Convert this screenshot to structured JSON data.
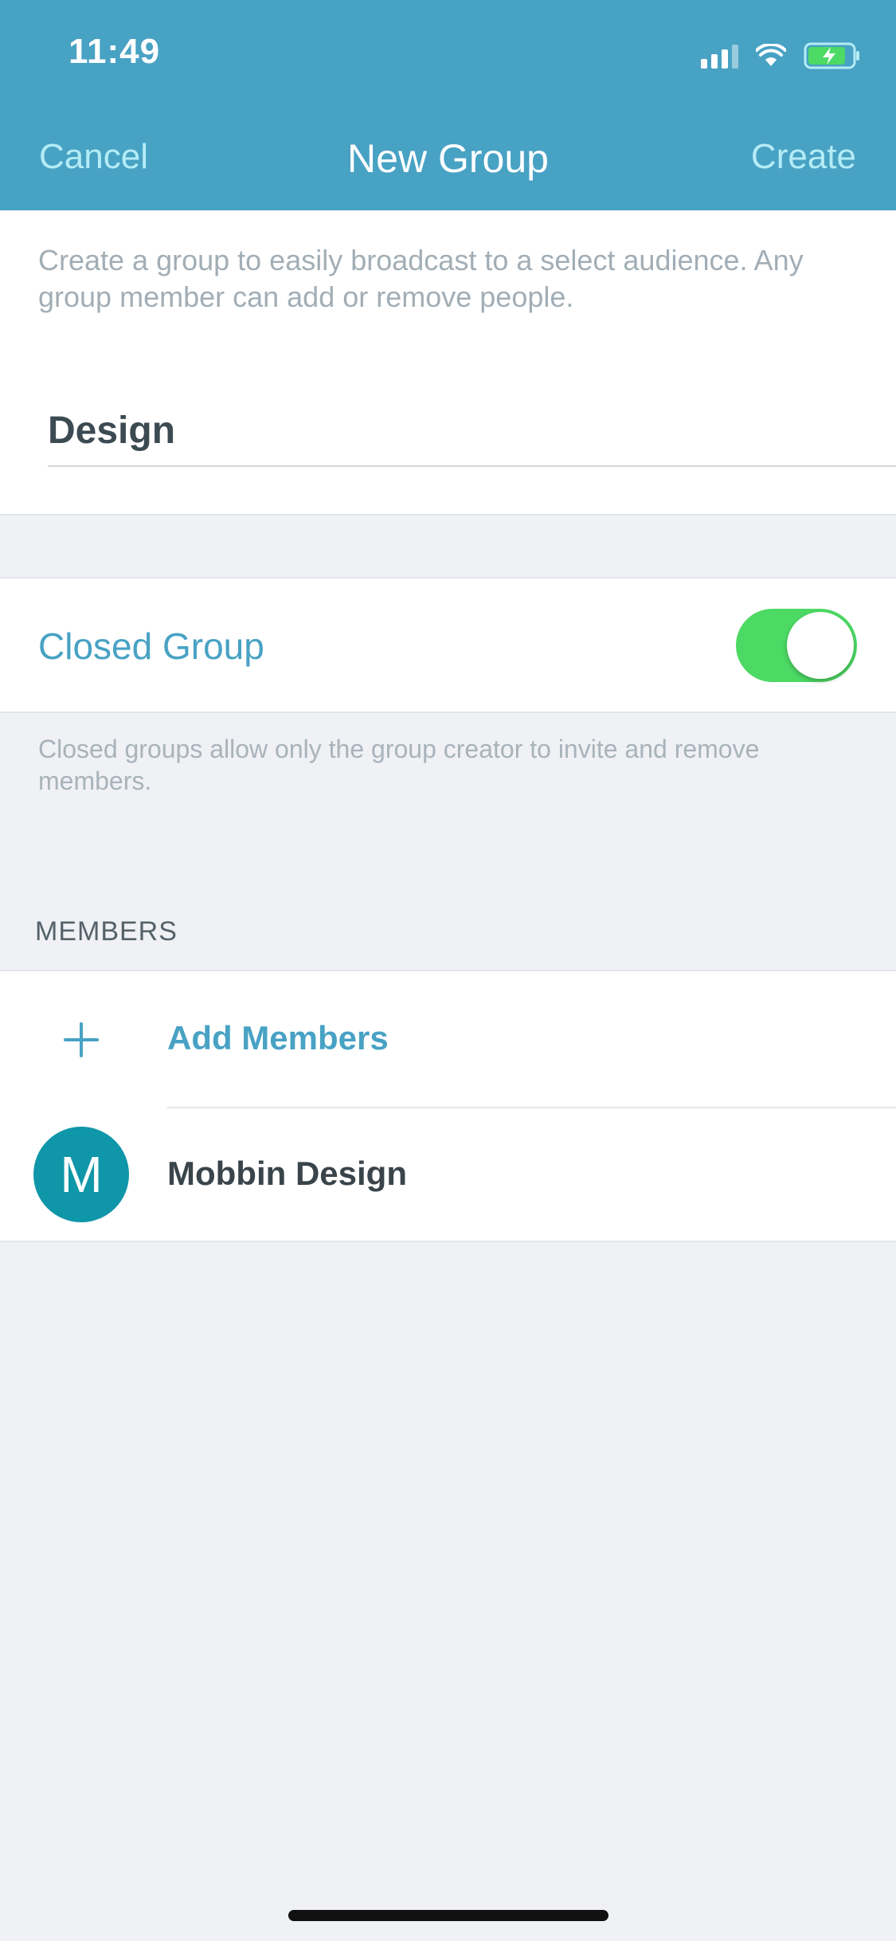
{
  "status_bar": {
    "time": "11:49",
    "icons": [
      "signal-icon",
      "wifi-icon",
      "battery-charging-icon"
    ]
  },
  "nav": {
    "cancel_label": "Cancel",
    "title": "New Group",
    "create_label": "Create"
  },
  "intro": {
    "description": "Create a group to easily broadcast to a select audience. Any group member can add or remove people.",
    "group_name_value": "Design"
  },
  "closed_group": {
    "label": "Closed Group",
    "enabled": true,
    "note": "Closed groups allow only the group creator to invite and remove members."
  },
  "members": {
    "header": "MEMBERS",
    "add_label": "Add Members",
    "list": [
      {
        "initial": "M",
        "name": "Mobbin Design"
      }
    ]
  },
  "colors": {
    "header": "#48a2c4",
    "accent": "#48a2c4",
    "toggle_on": "#4cd964",
    "avatar": "#0f96a8",
    "background": "#eff1f5"
  }
}
